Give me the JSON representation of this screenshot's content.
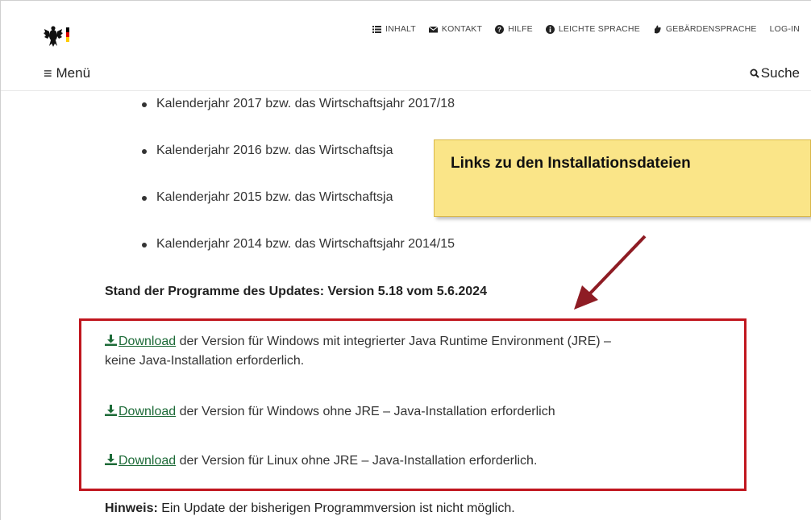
{
  "header": {
    "utility_nav": [
      {
        "label": "INHALT",
        "icon": "list-icon"
      },
      {
        "label": "KONTAKT",
        "icon": "envelope-icon"
      },
      {
        "label": "HILFE",
        "icon": "help-icon"
      },
      {
        "label": "LEICHTE SPRACHE",
        "icon": "info-icon"
      },
      {
        "label": "GEBÄRDENSPRACHE",
        "icon": "hand-icon"
      },
      {
        "label": "LOG-IN",
        "icon": ""
      }
    ],
    "menu_label": "Menü",
    "menu_icon": "≡",
    "search_label": "Suche"
  },
  "content": {
    "years": [
      "Kalenderjahr 2017 bzw. das Wirtschaftsjahr 2017/18",
      "Kalenderjahr 2016 bzw. das Wirtschaftsja",
      "Kalenderjahr 2015 bzw. das Wirtschaftsja",
      "Kalenderjahr 2014 bzw. das Wirtschaftsjahr 2014/15"
    ],
    "status": "Stand der Programme des Updates: Version 5.18 vom 5.6.2024",
    "downloads": [
      {
        "link": "Download",
        "text_line1": " der Version für Windows mit integrierter Java Runtime Environment (JRE) –",
        "text_line2": "keine  Java-Installation erforderlich."
      },
      {
        "link": "Download",
        "text_line1": " der Version für Windows ohne JRE – Java-Installation erforderlich",
        "text_line2": ""
      },
      {
        "link": "Download",
        "text_line1": " der Version für Linux ohne JRE – Java-Installation erforderlich.",
        "text_line2": ""
      }
    ],
    "hint_label": "Hinweis:",
    "hint_text": " Ein Update der bisherigen Programmversion ist nicht möglich."
  },
  "callout": {
    "text": "Links zu den Installationsdateien"
  },
  "colors": {
    "link": "#1c6a37",
    "highlight_border": "#c0161e",
    "callout_bg": "#fae588",
    "arrow": "#8e1c24"
  }
}
